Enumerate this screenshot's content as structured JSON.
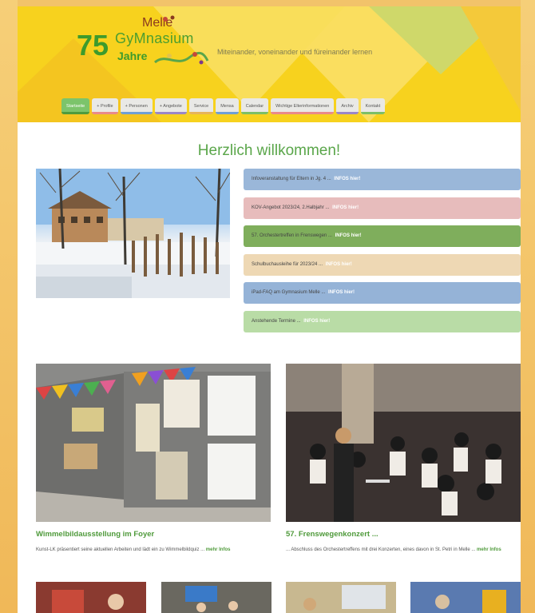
{
  "logo": {
    "number": "75",
    "word": "GyMnasium",
    "melle": "Melle",
    "jahre": "Jahre"
  },
  "tagline": "Miteinander, voneinander und füreinander lernen",
  "nav": [
    {
      "label": "Startseite",
      "active": true,
      "color": "#7cc46b"
    },
    {
      "label": "+ Profile",
      "active": false,
      "color": "#e98a8a"
    },
    {
      "label": "+ Personen",
      "active": false,
      "color": "#6f9fd6"
    },
    {
      "label": "+ Angebote",
      "active": false,
      "color": "#9b87c7"
    },
    {
      "label": "Service",
      "active": false,
      "color": "#e6b45a"
    },
    {
      "label": "Mensa",
      "active": false,
      "color": "#6f9fd6"
    },
    {
      "label": "Calendar",
      "active": false,
      "color": "#7cbf66"
    },
    {
      "label": "Wichtige Elterinformationen",
      "active": false,
      "color": "#e98a8a"
    },
    {
      "label": "Archiv",
      "active": false,
      "color": "#9b87c7"
    },
    {
      "label": "Kontakt",
      "active": false,
      "color": "#7cbf66"
    }
  ],
  "welcome": "Herzlich willkommen!",
  "info_boxes": [
    {
      "text": "Infoveranstaltung für Eltern in Jg. 4 ...",
      "more": "INFOS hier!",
      "bg": "#9ab7d9"
    },
    {
      "text": "KOV-Angebot 2023/24, 2.Halbjahr ...",
      "more": "INFOS hier!",
      "bg": "#e7bcbc"
    },
    {
      "text": "57. Orchestertreffen in Frenswegen ...",
      "more": "INFOS hier!",
      "bg": "#7fae5c"
    },
    {
      "text": "Schulbuchausleihe für 2023/24 ...",
      "more": "INFOS hier!",
      "bg": "#eed8b4"
    },
    {
      "text": "iPad-FAQ am Gymnasium Melle ...",
      "more": "INFOS hier!",
      "bg": "#95b3d7"
    },
    {
      "text": "Anstehende Termine ...",
      "more": "INFOS hier!",
      "bg": "#b9dca6"
    }
  ],
  "news": [
    {
      "title": "Wimmelbildausstellung im Foyer",
      "text": "Kunst-LK präsentiert seine aktuellen Arbeiten und lädt ein zu Wimmelbildquiz ...",
      "more": "mehr Infos"
    },
    {
      "title": "57. Frenswegenkonzert ...",
      "text": "... Abschluss des Orchestertreffens mit drei Konzerten, eines davon in St. Petri in Melle ...",
      "more": "mehr Infos"
    }
  ],
  "colors": {
    "header_yellow": "#f7d21e",
    "accent_green": "#5aa64a",
    "page_orange": "#f2c36a"
  }
}
